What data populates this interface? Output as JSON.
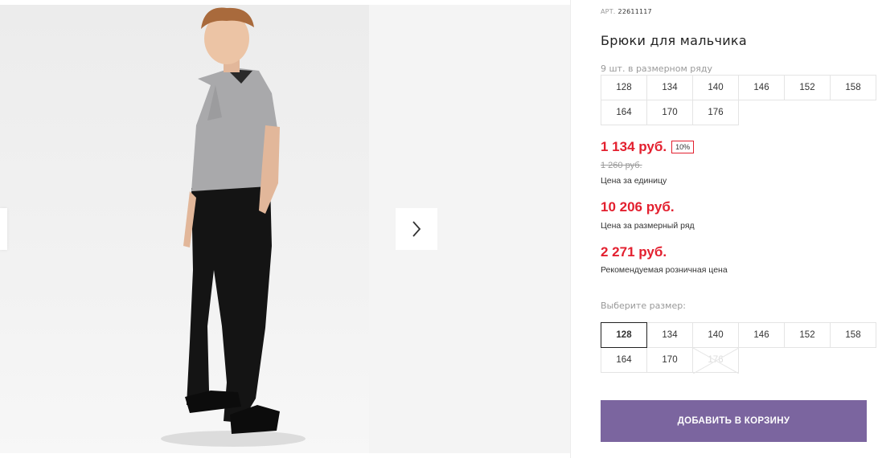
{
  "product": {
    "sku_label": "АРТ.",
    "sku": "22611117",
    "title": "Брюки для мальчика",
    "row_note": "9 шт. в размерном ряду",
    "row_sizes": [
      "128",
      "134",
      "140",
      "146",
      "152",
      "158",
      "164",
      "170",
      "176"
    ]
  },
  "pricing": {
    "unit_price": "1 134 руб.",
    "discount": "10%",
    "old_price": "1 260 руб.",
    "unit_caption": "Цена за единицу",
    "row_price": "10 206 руб.",
    "row_caption": "Цена за размерный ряд",
    "rrp_price": "2 271 руб.",
    "rrp_caption": "Рекомендуемая розничная цена"
  },
  "size_picker": {
    "label": "Выберите размер:",
    "sizes": [
      "128",
      "134",
      "140",
      "146",
      "152",
      "158",
      "164",
      "170",
      "176"
    ],
    "selected": "128",
    "unavailable": [
      "176"
    ]
  },
  "cart": {
    "button_label": "ДОБАВИТЬ В КОРЗИНУ"
  },
  "colors": {
    "price_red": "#e3202f",
    "button_purple": "#7b659f"
  },
  "icons": {
    "next": "chevron-right-icon",
    "prev": "chevron-left-icon"
  }
}
